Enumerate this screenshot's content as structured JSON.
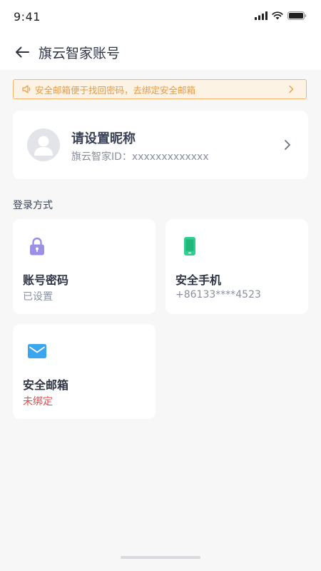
{
  "status_bar": {
    "time": "9:41"
  },
  "nav": {
    "back_icon": "back-arrow-icon",
    "title": "旗云智家账号"
  },
  "notice": {
    "icon": "speaker-icon",
    "text": "安全邮箱便于找回密码，去绑定安全邮箱",
    "colors": {
      "background": "#fdf3e4",
      "border": "#f4b46a",
      "text": "#e89a44"
    }
  },
  "profile": {
    "avatar_icon": "default-avatar-icon",
    "nickname": "请设置昵称",
    "id_text": "旗云智家ID：xxxxxxxxxxxxx"
  },
  "login_section": {
    "title": "登录方式",
    "cards": [
      {
        "icon": "lock-icon",
        "icon_color": "#9b8fe8",
        "title": "账号密码",
        "subtitle": "已设置"
      },
      {
        "icon": "phone-icon",
        "icon_color": "#2ecf8f",
        "title": "安全手机",
        "subtitle": "+86133****4523"
      },
      {
        "icon": "mail-icon",
        "icon_color": "#3aa6ef",
        "title": "安全邮箱",
        "subtitle": "未绑定",
        "subtitle_color": "#e5484d"
      }
    ]
  }
}
